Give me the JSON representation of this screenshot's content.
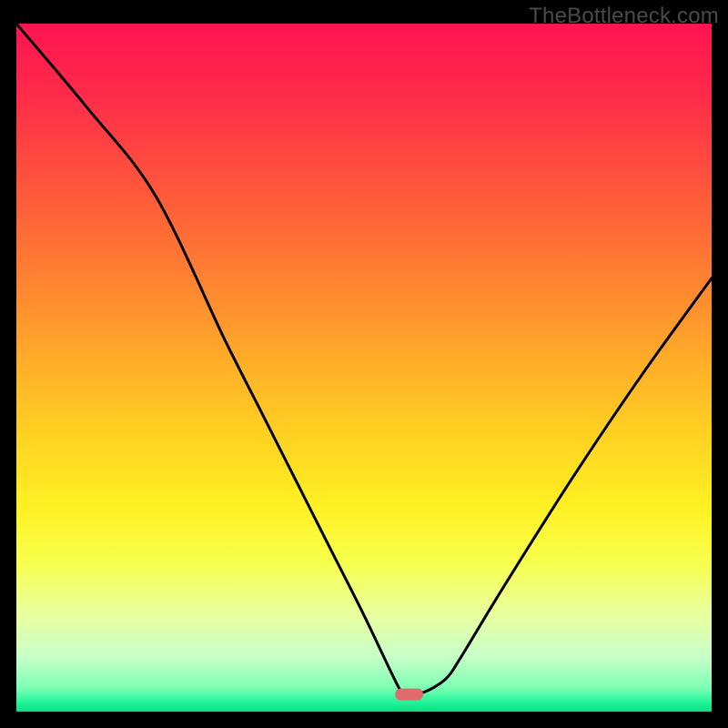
{
  "watermark": "TheBottleneck.com",
  "chart_data": {
    "type": "line",
    "title": "",
    "xlabel": "",
    "ylabel": "",
    "xlim": [
      0,
      100
    ],
    "ylim": [
      0,
      100
    ],
    "grid": false,
    "series": [
      {
        "name": "bottleneck-curve",
        "x": [
          0,
          10,
          20,
          30,
          35,
          40,
          45,
          50,
          55,
          56,
          57,
          58,
          60,
          62,
          64,
          70,
          80,
          90,
          100
        ],
        "y": [
          100,
          88,
          75,
          54,
          44,
          34,
          24,
          14,
          3.5,
          2.8,
          2.5,
          2.6,
          3.5,
          5,
          8,
          18,
          34,
          49,
          63
        ]
      }
    ],
    "marker": {
      "name": "optimal-point",
      "x": 56.5,
      "y": 2.5,
      "width": 4,
      "shape": "rounded-rect",
      "color": "#e16a6e"
    },
    "background_gradient": {
      "stops": [
        {
          "offset": 0.0,
          "color": "#ff1450"
        },
        {
          "offset": 0.1,
          "color": "#ff2a4a"
        },
        {
          "offset": 0.2,
          "color": "#ff4a3f"
        },
        {
          "offset": 0.3,
          "color": "#ff6a36"
        },
        {
          "offset": 0.4,
          "color": "#ff8c2f"
        },
        {
          "offset": 0.5,
          "color": "#ffb028"
        },
        {
          "offset": 0.6,
          "color": "#ffd222"
        },
        {
          "offset": 0.7,
          "color": "#fff023"
        },
        {
          "offset": 0.78,
          "color": "#f7ff4a"
        },
        {
          "offset": 0.86,
          "color": "#e8ffa0"
        },
        {
          "offset": 0.92,
          "color": "#c8ffc8"
        },
        {
          "offset": 0.965,
          "color": "#7effb4"
        },
        {
          "offset": 0.985,
          "color": "#27f59b"
        },
        {
          "offset": 1.0,
          "color": "#0cde82"
        }
      ]
    }
  }
}
